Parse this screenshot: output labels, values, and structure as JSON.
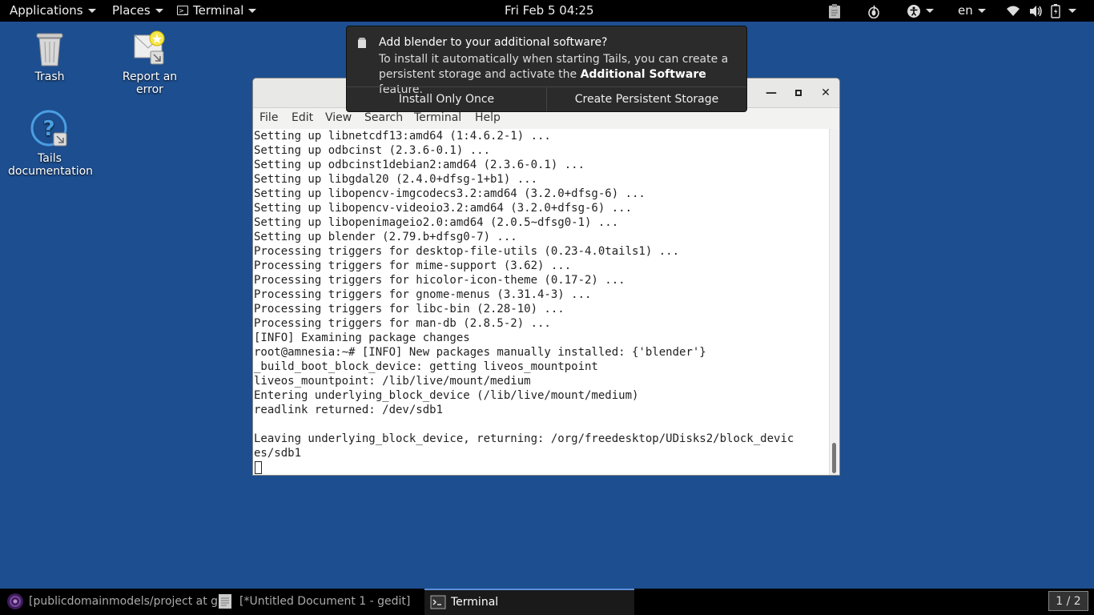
{
  "topbar": {
    "applications": "Applications",
    "places": "Places",
    "terminal": "Terminal",
    "clock": "Fri Feb 5  04:25",
    "language": "en"
  },
  "desktop": {
    "icons": [
      {
        "label": "Trash"
      },
      {
        "label": "Report an error"
      },
      {
        "label": "Tails documentation"
      }
    ]
  },
  "notification": {
    "title": "Add blender to your additional software?",
    "body_line1": "To install it automatically when starting Tails, you can create a",
    "body_line2_prefix": "persistent storage and activate the ",
    "body_line2_bold": "Additional Software",
    "body_line2_suffix": " feature.",
    "btn_install_once": "Install Only Once",
    "btn_create_storage": "Create Persistent Storage"
  },
  "terminal_window": {
    "menu": [
      "File",
      "Edit",
      "View",
      "Search",
      "Terminal",
      "Help"
    ],
    "lines": [
      "Setting up libnetcdf13:amd64 (1:4.6.2-1) ...",
      "Setting up odbcinst (2.3.6-0.1) ...",
      "Setting up odbcinst1debian2:amd64 (2.3.6-0.1) ...",
      "Setting up libgdal20 (2.4.0+dfsg-1+b1) ...",
      "Setting up libopencv-imgcodecs3.2:amd64 (3.2.0+dfsg-6) ...",
      "Setting up libopencv-videoio3.2:amd64 (3.2.0+dfsg-6) ...",
      "Setting up libopenimageio2.0:amd64 (2.0.5~dfsg0-1) ...",
      "Setting up blender (2.79.b+dfsg0-7) ...",
      "Processing triggers for desktop-file-utils (0.23-4.0tails1) ...",
      "Processing triggers for mime-support (3.62) ...",
      "Processing triggers for hicolor-icon-theme (0.17-2) ...",
      "Processing triggers for gnome-menus (3.31.4-3) ...",
      "Processing triggers for libc-bin (2.28-10) ...",
      "Processing triggers for man-db (2.8.5-2) ...",
      "[INFO] Examining package changes",
      "root@amnesia:~# [INFO] New packages manually installed: {'blender'}",
      "_build_boot_block_device: getting liveos_mountpoint",
      "liveos_mountpoint: /lib/live/mount/medium",
      "Entering underlying_block_device (/lib/live/mount/medium)",
      "readlink returned: /dev/sdb1",
      "",
      "Leaving underlying_block_device, returning: /org/freedesktop/UDisks2/block_devic",
      "es/sdb1"
    ]
  },
  "taskbar": {
    "tasks": [
      "[publicdomainmodels/project at g...",
      "[*Untitled Document 1 - gedit]",
      "Terminal"
    ],
    "workspace": "1 / 2"
  },
  "colors": {
    "desktop_bg": "#1d4e8f",
    "bar_bg": "#000000",
    "notification_bg": "#2b2b2b"
  }
}
